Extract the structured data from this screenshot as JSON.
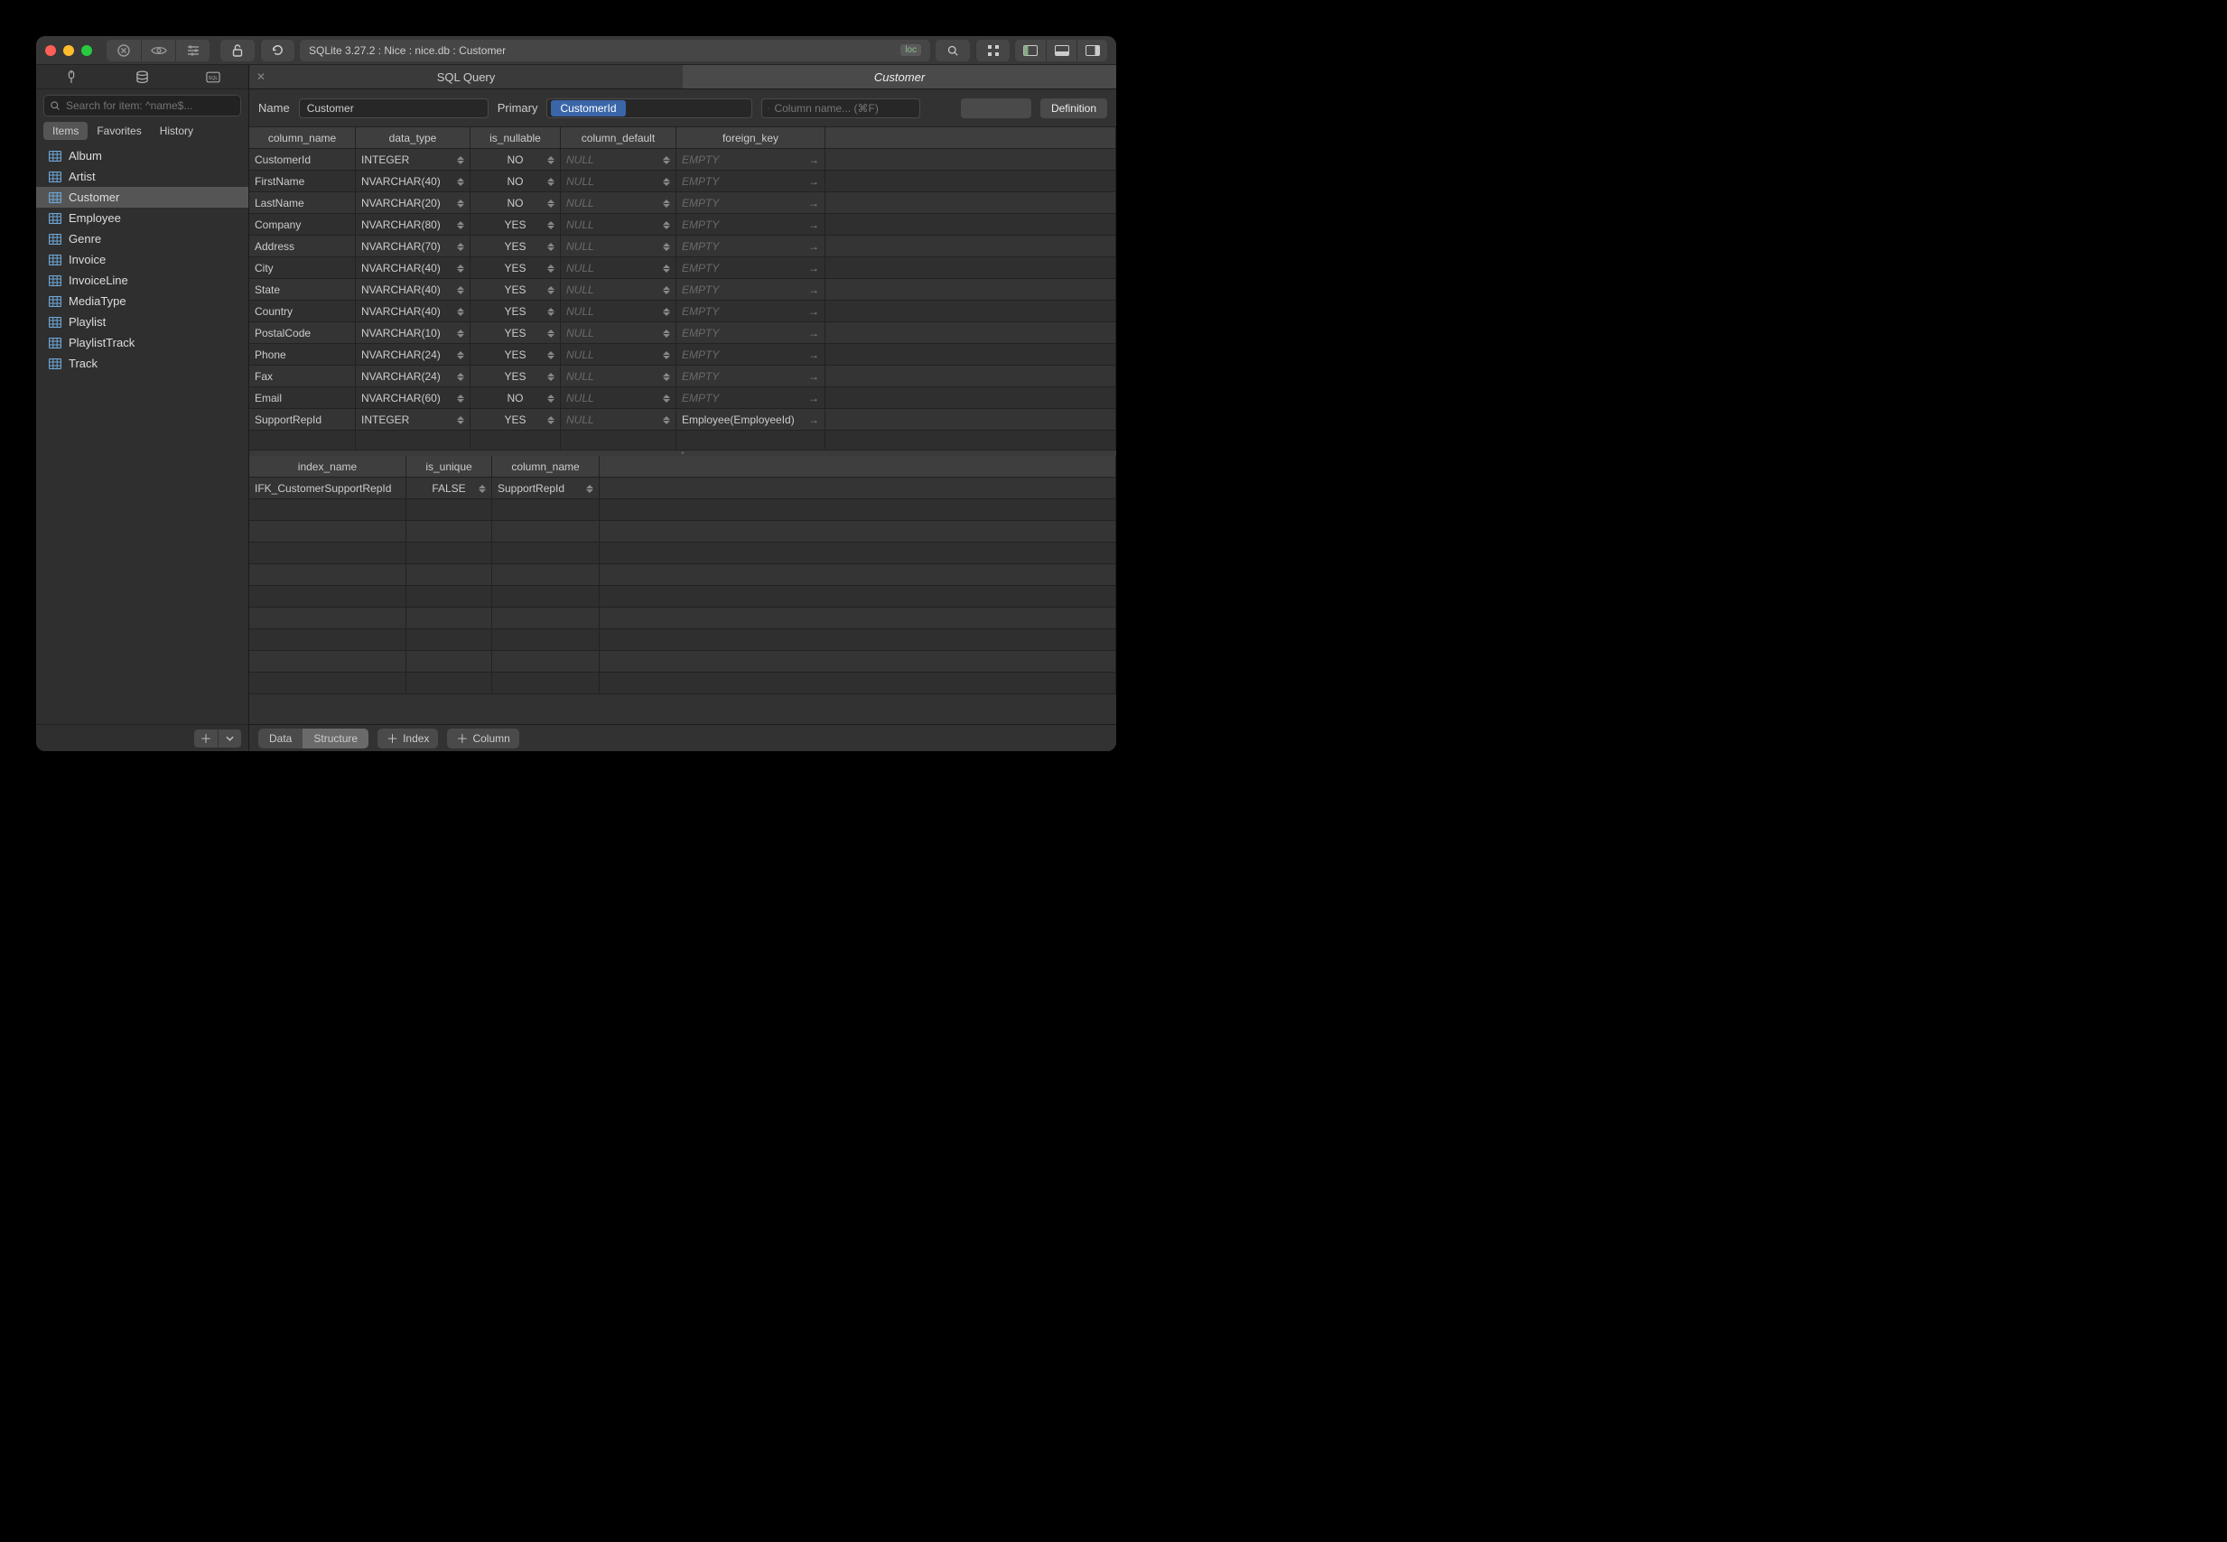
{
  "titlebar": {
    "breadcrumb": "SQLite 3.27.2 : Nice : nice.db : Customer",
    "loc_badge": "loc"
  },
  "sidebar": {
    "search_placeholder": "Search for item: ^name$...",
    "segments": {
      "items": "Items",
      "favorites": "Favorites",
      "history": "History"
    },
    "tables": [
      "Album",
      "Artist",
      "Customer",
      "Employee",
      "Genre",
      "Invoice",
      "InvoiceLine",
      "MediaType",
      "Playlist",
      "PlaylistTrack",
      "Track"
    ],
    "selected": "Customer"
  },
  "tabs": {
    "sql": "SQL Query",
    "active": "Customer"
  },
  "header": {
    "name_label": "Name",
    "name_value": "Customer",
    "primary_label": "Primary",
    "primary_value": "CustomerId",
    "col_search_placeholder": "Column name... (⌘F)",
    "definition_btn": "Definition"
  },
  "columns_table": {
    "headers": {
      "column_name": "column_name",
      "data_type": "data_type",
      "is_nullable": "is_nullable",
      "column_default": "column_default",
      "foreign_key": "foreign_key"
    },
    "null_text": "NULL",
    "empty_text": "EMPTY",
    "rows": [
      {
        "name": "CustomerId",
        "type": "INTEGER",
        "nullable": "NO",
        "default": "NULL",
        "fk": "EMPTY"
      },
      {
        "name": "FirstName",
        "type": "NVARCHAR(40)",
        "nullable": "NO",
        "default": "NULL",
        "fk": "EMPTY"
      },
      {
        "name": "LastName",
        "type": "NVARCHAR(20)",
        "nullable": "NO",
        "default": "NULL",
        "fk": "EMPTY"
      },
      {
        "name": "Company",
        "type": "NVARCHAR(80)",
        "nullable": "YES",
        "default": "NULL",
        "fk": "EMPTY"
      },
      {
        "name": "Address",
        "type": "NVARCHAR(70)",
        "nullable": "YES",
        "default": "NULL",
        "fk": "EMPTY"
      },
      {
        "name": "City",
        "type": "NVARCHAR(40)",
        "nullable": "YES",
        "default": "NULL",
        "fk": "EMPTY"
      },
      {
        "name": "State",
        "type": "NVARCHAR(40)",
        "nullable": "YES",
        "default": "NULL",
        "fk": "EMPTY"
      },
      {
        "name": "Country",
        "type": "NVARCHAR(40)",
        "nullable": "YES",
        "default": "NULL",
        "fk": "EMPTY"
      },
      {
        "name": "PostalCode",
        "type": "NVARCHAR(10)",
        "nullable": "YES",
        "default": "NULL",
        "fk": "EMPTY"
      },
      {
        "name": "Phone",
        "type": "NVARCHAR(24)",
        "nullable": "YES",
        "default": "NULL",
        "fk": "EMPTY"
      },
      {
        "name": "Fax",
        "type": "NVARCHAR(24)",
        "nullable": "YES",
        "default": "NULL",
        "fk": "EMPTY"
      },
      {
        "name": "Email",
        "type": "NVARCHAR(60)",
        "nullable": "NO",
        "default": "NULL",
        "fk": "EMPTY"
      },
      {
        "name": "SupportRepId",
        "type": "INTEGER",
        "nullable": "YES",
        "default": "NULL",
        "fk": "Employee(EmployeeId)"
      }
    ]
  },
  "index_table": {
    "headers": {
      "index_name": "index_name",
      "is_unique": "is_unique",
      "column_name": "column_name"
    },
    "rows": [
      {
        "name": "IFK_CustomerSupportRepId",
        "unique": "FALSE",
        "column": "SupportRepId"
      }
    ]
  },
  "bottom": {
    "data": "Data",
    "structure": "Structure",
    "index": "Index",
    "column": "Column"
  }
}
